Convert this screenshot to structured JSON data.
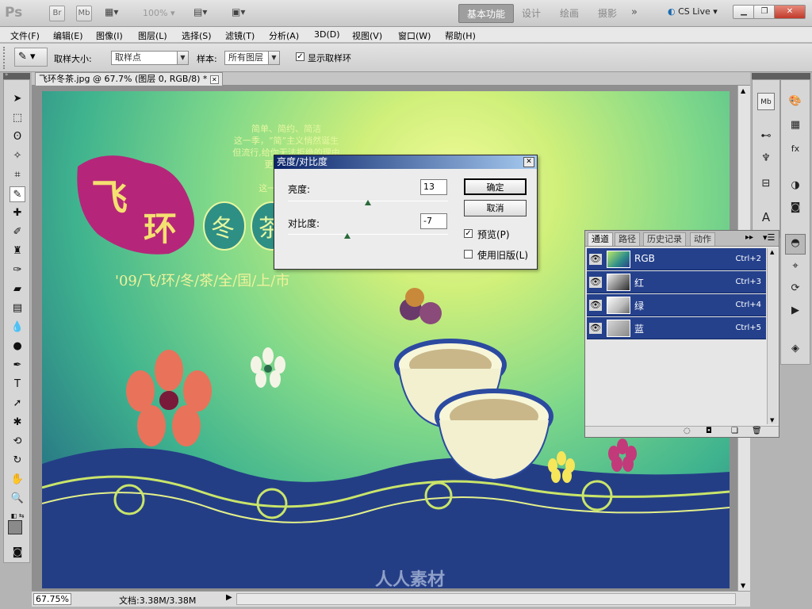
{
  "appbar": {
    "logo": "Ps",
    "br": "Br",
    "mb": "Mb",
    "zoom": "100%",
    "workspaces": [
      "基本功能",
      "设计",
      "绘画",
      "摄影"
    ],
    "more": "»",
    "cslive": "CS Live"
  },
  "menu": [
    "文件(F)",
    "编辑(E)",
    "图像(I)",
    "图层(L)",
    "选择(S)",
    "滤镜(T)",
    "分析(A)",
    "3D(D)",
    "视图(V)",
    "窗口(W)",
    "帮助(H)"
  ],
  "options": {
    "sample_size_label": "取样大小:",
    "sample_size_value": "取样点",
    "sample_label": "样本:",
    "sample_value": "所有图层",
    "show_ring_label": "显示取样环",
    "show_ring_checked": true
  },
  "document": {
    "tab_title": "飞环冬茶.jpg @ 67.7% (图层 0, RGB/8) *",
    "zoom": "67.75%",
    "doc_info": "文档:3.38M/3.38M"
  },
  "image_art": {
    "poem": [
      "简单、简约、简洁",
      "这一季，“简”主义悄然诞生",
      "但流行,给你无法拒绝的理由",
      "更甚是失去",
      "拥抱",
      "这一季,与流行"
    ],
    "title_chars": [
      "飞",
      "环",
      "冬",
      "茶"
    ],
    "subtitle": "'09/飞/环/冬/茶/全/国/上/市",
    "watermark": "人人素材"
  },
  "dialog": {
    "title": "亮度/对比度",
    "brightness_label": "亮度:",
    "brightness_value": "13",
    "brightness_level": 0.5,
    "contrast_label": "对比度:",
    "contrast_value": "-7",
    "contrast_level": 0.37,
    "ok": "确定",
    "cancel": "取消",
    "preview_label": "预览(P)",
    "preview_checked": true,
    "legacy_label": "使用旧版(L)",
    "legacy_checked": false
  },
  "channels_panel": {
    "tabs": [
      "通道",
      "路径",
      "历史记录",
      "动作"
    ],
    "rows": [
      {
        "name": "RGB",
        "shortcut": "Ctrl+2"
      },
      {
        "name": "红",
        "shortcut": "Ctrl+3"
      },
      {
        "name": "绿",
        "shortcut": "Ctrl+4"
      },
      {
        "name": "蓝",
        "shortcut": "Ctrl+5"
      }
    ]
  },
  "colors": {
    "accent_selected": "#25418c",
    "dialog_title": "#0a246a"
  }
}
